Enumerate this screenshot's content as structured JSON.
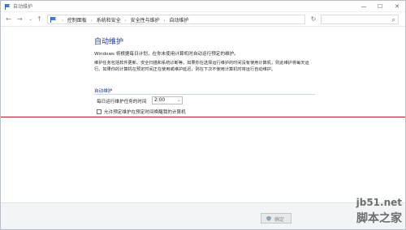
{
  "window": {
    "title": "自动维护",
    "controls": {
      "minimize": "—",
      "maximize": "☐",
      "close": "✕"
    }
  },
  "navigation": {
    "back": "←",
    "forward": "→",
    "up": "↑",
    "breadcrumbs": [
      "控制面板",
      "系统和安全",
      "安全性与维护",
      "自动维护"
    ],
    "refresh_icon": "refresh-icon",
    "search_icon": "search-icon"
  },
  "content": {
    "heading": "自动维护",
    "intro": "Windows 将根据每日计划，在你未使用计算机时自动运行预定的维护。",
    "description": "维护任务包括软件更新、安全扫描和系统诊断等。如果你在选择运行维护的时间没有使用计算机，则此维护将每天运行。如果你的计算机在预定时间正在使用或维护延迟，则在下次不使用计算机时将运行自动维护。",
    "section_title": "自动维护",
    "time_label": "每日运行维护任务的时间",
    "time_value": "2:00",
    "wake_label": "允许预定维护在预定时间唤醒我的计算机",
    "wake_checked": false
  },
  "footer": {
    "ok_label": "确定"
  },
  "watermark": {
    "line1": "jb51.net",
    "line2": "脚本之家"
  },
  "colors": {
    "accent": "#1f3a8a",
    "annotation_line": "#c0181c"
  }
}
